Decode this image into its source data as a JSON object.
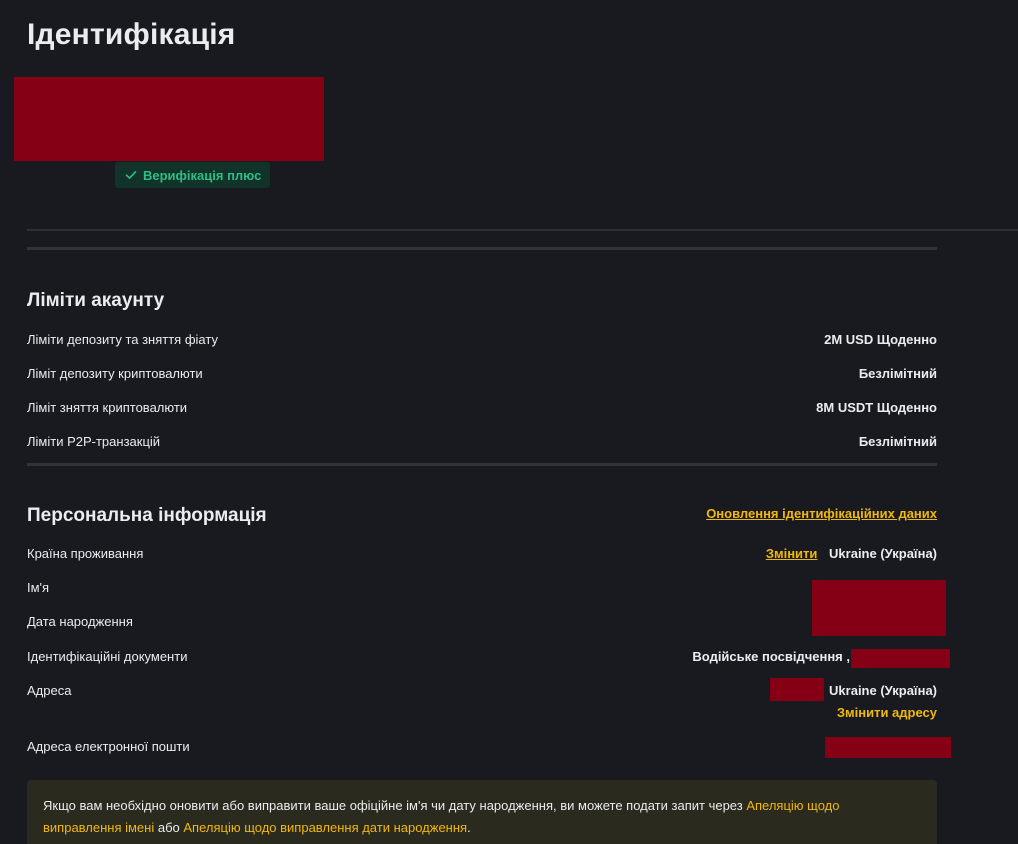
{
  "header": {
    "title": "Ідентифікація",
    "verification_badge": "Верифікація плюс"
  },
  "limits": {
    "title": "Ліміти акаунту",
    "rows": [
      {
        "label": "Ліміти депозиту та зняття фіату",
        "value": "2M USD Щоденно"
      },
      {
        "label": "Ліміт депозиту криптовалюти",
        "value": "Безлімітний"
      },
      {
        "label": "Ліміт зняття криптовалюти",
        "value": "8M USDT Щоденно"
      },
      {
        "label": "Ліміти P2P-транзакцій",
        "value": "Безлімітний"
      }
    ]
  },
  "personal": {
    "title": "Персональна інформація",
    "update_link": "Оновлення ідентифікаційних даних",
    "country": {
      "label": "Країна проживання",
      "change_link": "Змінити",
      "value": "Ukraine (Україна)"
    },
    "name": {
      "label": "Ім'я"
    },
    "birthdate": {
      "label": "Дата народження"
    },
    "documents": {
      "label": "Ідентифікаційні документи",
      "value": "Водійське посвідчення ,"
    },
    "address": {
      "label": "Адреса",
      "value": "Ukraine (Україна)",
      "change_link": "Змінити адресу"
    },
    "email": {
      "label": "Адреса електронної пошти"
    }
  },
  "notice": {
    "text_before": "Якщо вам необхідно оновити або виправити ваше офіційне ім'я чи дату народження, ви можете подати запит через ",
    "link_name": "Апеляцію щодо виправлення імені",
    "text_middle": " або ",
    "link_date": "Апеляцію щодо виправлення дати народження",
    "text_after": "."
  },
  "colors": {
    "background": "#181a20",
    "accent_yellow": "#f0b90b",
    "success_green": "#2ebd85",
    "redaction": "#850014"
  }
}
